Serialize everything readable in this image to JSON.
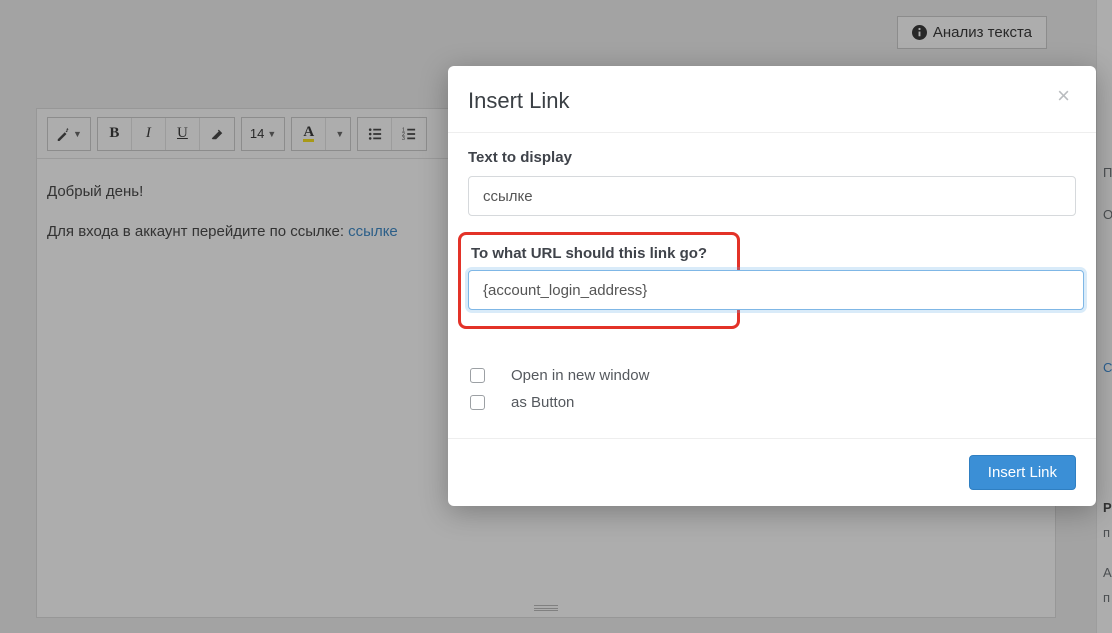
{
  "header": {
    "analyze_label": "Анализ текста"
  },
  "toolbar": {
    "bold": "B",
    "italic": "I",
    "underline": "U",
    "fontsize": "14",
    "fontcolor_letter": "A"
  },
  "editor": {
    "greeting": "Добрый день!",
    "line2_prefix": "Для входа в аккаунт перейдите по ссылке: ",
    "line2_link": "ссылке"
  },
  "modal": {
    "title": "Insert Link",
    "text_to_display_label": "Text to display",
    "text_to_display_value": "ссылке",
    "url_label": "To what URL should this link go?",
    "url_value": "{account_login_address}",
    "open_new_window_label": "Open in new window",
    "as_button_label": "as Button",
    "submit_label": "Insert Link"
  },
  "side": {
    "s1": "П",
    "s2": "O",
    "s3": "С",
    "s4": "Р",
    "s5": "п",
    "s6": "А",
    "s7": "п"
  }
}
